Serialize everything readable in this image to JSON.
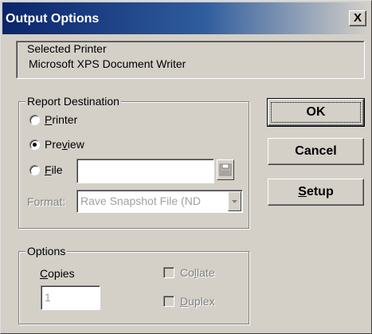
{
  "window": {
    "title": "Output Options",
    "close_glyph": "X",
    "titlebar_color": "#0a246a",
    "face_color": "#d4d0c8"
  },
  "selected_printer": {
    "legend": "Selected Printer",
    "value": "Microsoft XPS Document Writer"
  },
  "report_destination": {
    "legend": "Report Destination",
    "options": [
      {
        "label_mnemonic": "P",
        "label_rest": "rinter",
        "selected": false
      },
      {
        "label_pre": "Pre",
        "label_mnemonic": "v",
        "label_rest": "iew",
        "selected": true
      },
      {
        "label_mnemonic": "F",
        "label_rest": "ile",
        "selected": false
      }
    ],
    "file_path": "",
    "save_icon": "floppy-disk-icon",
    "format_label": "Format:",
    "format_value": "Rave Snapshot File (ND"
  },
  "options": {
    "legend": "Options",
    "copies_mnemonic": "C",
    "copies_rest": "opies",
    "copies_value": "1",
    "collate_pre": "Co",
    "collate_mnemonic": "l",
    "collate_rest": "late",
    "duplex_mnemonic": "D",
    "duplex_rest": "uplex"
  },
  "buttons": {
    "ok": "OK",
    "cancel": "Cancel",
    "setup_mnemonic": "S",
    "setup_rest": "etup"
  }
}
